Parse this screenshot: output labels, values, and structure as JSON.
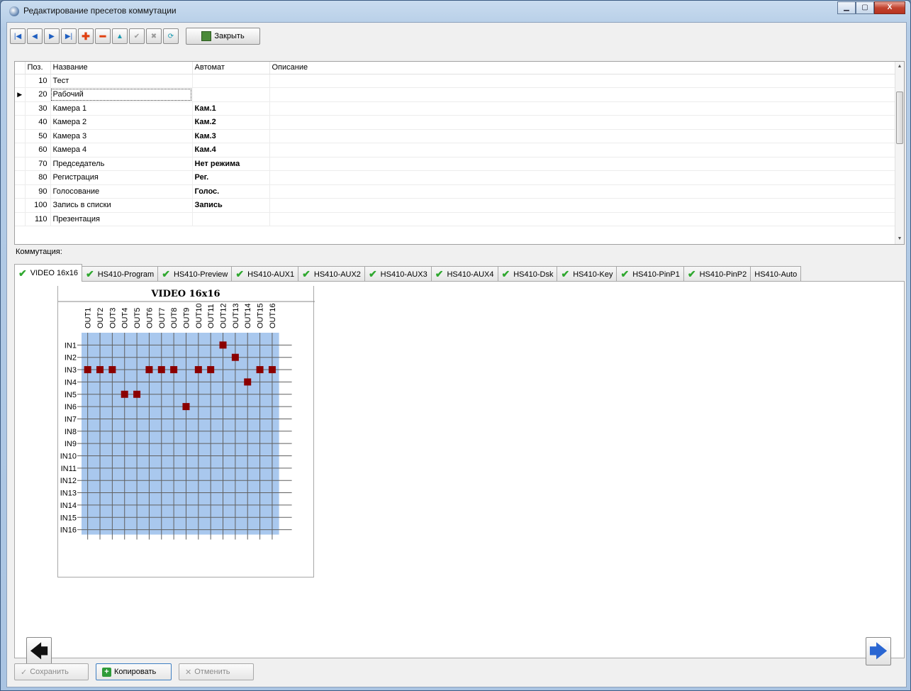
{
  "window": {
    "title": "Редактирование пресетов коммутации",
    "minimize": "▁",
    "maximize": "▢",
    "close": "X"
  },
  "toolbar": {
    "first": "|◀",
    "prev": "◀",
    "next": "▶",
    "last": "▶|",
    "add": "✚",
    "remove": "━",
    "up": "▲",
    "confirm": "✔",
    "cancel": "✖",
    "refresh": "⟳",
    "close_label": "Закрыть"
  },
  "grid": {
    "headers": [
      "Поз.",
      "Название",
      "Автомат",
      "Описание"
    ],
    "rows": [
      {
        "pos": "10",
        "name": "Тест",
        "auto": "",
        "desc": ""
      },
      {
        "pos": "20",
        "name": "Рабочий",
        "auto": "",
        "desc": ""
      },
      {
        "pos": "30",
        "name": "Камера 1",
        "auto": "Кам.1",
        "desc": ""
      },
      {
        "pos": "40",
        "name": "Камера 2",
        "auto": "Кам.2",
        "desc": ""
      },
      {
        "pos": "50",
        "name": "Камера 3",
        "auto": "Кам.3",
        "desc": ""
      },
      {
        "pos": "60",
        "name": "Камера 4",
        "auto": "Кам.4",
        "desc": ""
      },
      {
        "pos": "70",
        "name": "Председатель",
        "auto": "Нет режима",
        "desc": ""
      },
      {
        "pos": "80",
        "name": "Регистрация",
        "auto": "Рег.",
        "desc": ""
      },
      {
        "pos": "90",
        "name": "Голосование",
        "auto": "Голос.",
        "desc": ""
      },
      {
        "pos": "100",
        "name": "Запись в списки",
        "auto": "Запись",
        "desc": ""
      },
      {
        "pos": "110",
        "name": "Презентация",
        "auto": "",
        "desc": ""
      }
    ],
    "current_row_index": 1
  },
  "section_label": "Коммутация:",
  "tabs": [
    {
      "label": "VIDEO 16x16",
      "checked": true,
      "active": true
    },
    {
      "label": "HS410-Program",
      "checked": true
    },
    {
      "label": "HS410-Preview",
      "checked": true
    },
    {
      "label": "HS410-AUX1",
      "checked": true
    },
    {
      "label": "HS410-AUX2",
      "checked": true
    },
    {
      "label": "HS410-AUX3",
      "checked": true
    },
    {
      "label": "HS410-AUX4",
      "checked": true
    },
    {
      "label": "HS410-Dsk",
      "checked": true
    },
    {
      "label": "HS410-Key",
      "checked": true
    },
    {
      "label": "HS410-PinP1",
      "checked": true
    },
    {
      "label": "HS410-PinP2",
      "checked": true
    },
    {
      "label": "HS410-Auto",
      "checked": false
    }
  ],
  "matrix": {
    "title": "VIDEO 16x16",
    "outputs": [
      "OUT1",
      "OUT2",
      "OUT3",
      "OUT4",
      "OUT5",
      "OUT6",
      "OUT7",
      "OUT8",
      "OUT9",
      "OUT10",
      "OUT11",
      "OUT12",
      "OUT13",
      "OUT14",
      "OUT15",
      "OUT16"
    ],
    "inputs": [
      "IN1",
      "IN2",
      "IN3",
      "IN4",
      "IN5",
      "IN6",
      "IN7",
      "IN8",
      "IN9",
      "IN10",
      "IN11",
      "IN12",
      "IN13",
      "IN14",
      "IN15",
      "IN16"
    ],
    "routing_input_for_output": [
      3,
      3,
      3,
      5,
      5,
      3,
      3,
      3,
      6,
      3,
      3,
      1,
      2,
      4,
      3,
      3
    ],
    "colors": {
      "cell": "#a9c8ee",
      "point": "#8b0000",
      "grid": "#606060"
    }
  },
  "nav": {
    "back_icon": "🡄",
    "forward_icon": "🡆"
  },
  "buttons": {
    "save": "Сохранить",
    "copy": "Копировать",
    "cancel": "Отменить"
  }
}
